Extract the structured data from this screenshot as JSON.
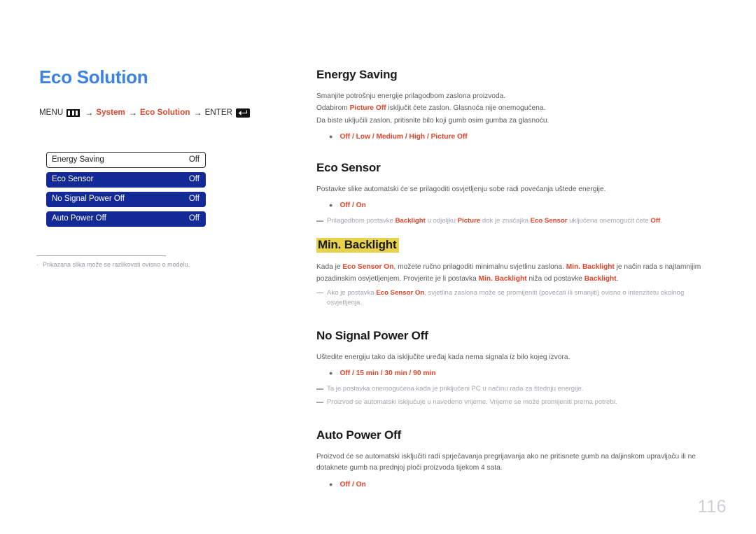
{
  "page": {
    "title": "Eco Solution",
    "number": "116"
  },
  "breadcrumb": {
    "menu_label": "MENU",
    "menu_icon": "menu-bars-icon",
    "arrow": "→",
    "step1": "System",
    "step2": "Eco Solution",
    "enter_label": "ENTER",
    "enter_icon": "enter-return-icon"
  },
  "osd": {
    "rows": [
      {
        "label": "Energy Saving",
        "value": "Off",
        "selected": true
      },
      {
        "label": "Eco Sensor",
        "value": "Off",
        "selected": false
      },
      {
        "label": "No Signal Power Off",
        "value": "Off",
        "selected": false
      },
      {
        "label": "Auto Power Off",
        "value": "Off",
        "selected": false
      }
    ]
  },
  "left_note": {
    "bullet": "·",
    "text": "Prikazana slika može se razlikovati ovisno o modelu."
  },
  "sections": {
    "energy_saving": {
      "title": "Energy Saving",
      "p1": "Smanjite potrošnju energije prilagodbom zaslona proizvoda.",
      "p2_a": "Odabirom ",
      "p2_b": "Picture Off",
      "p2_c": " isključit ćete zaslon. Glasnoća nije onemogućena.",
      "p3": "Da biste uključili zaslon, pritisnite bilo koji gumb osim gumba za glasnoću.",
      "options": "Off / Low / Medium / High / Picture Off"
    },
    "eco_sensor": {
      "title": "Eco Sensor",
      "p1": "Postavke slike automatski će se prilagoditi osvjetljenju sobe radi povećanja uštede energije.",
      "options": "Off / On",
      "note_a": "Prilagodbom postavke ",
      "note_b": "Backlight",
      "note_c": " u odjeljku ",
      "note_d": "Picture",
      "note_e": " dok je značajka ",
      "note_f": "Eco Sensor",
      "note_g": " uključena onemogućit ćete ",
      "note_h": "Off",
      "note_i": "."
    },
    "min_backlight": {
      "title": "Min. Backlight",
      "p1_a": "Kada je ",
      "p1_b": "Eco Sensor On",
      "p1_c": ", možete ručno prilagoditi minimalnu svjetlinu zaslona. ",
      "p1_d": "Min. Backlight",
      "p1_e": " je način rada s najtamnijim pozadinskim osvjetljenjem. Provjerite je li postavka ",
      "p1_f": "Min. Backlight",
      "p1_g": " niža od postavke ",
      "p1_h": "Backlight",
      "p1_i": ".",
      "note_a": "Ako je postavka ",
      "note_b": "Eco Sensor On",
      "note_c": ", svjetlina zaslona može se promijeniti (povećati ili smanjiti) ovisno o intenzitetu okolnog osvjetljenja."
    },
    "no_signal_power_off": {
      "title": "No Signal Power Off",
      "p1": "Uštedite energiju tako da isključite uređaj kada nema signala iz bilo kojeg izvora.",
      "options": "Off / 15 min / 30 min / 90 min",
      "note1": "Ta je postavka onemogućena kada je priključeni PC u načinu rada za štednju energije.",
      "note2": "Proizvod se automatski isključuje u navedeno vrijeme. Vrijeme se može promijeniti prema potrebi."
    },
    "auto_power_off": {
      "title": "Auto Power Off",
      "p1": "Proizvod će se automatski isključiti radi sprječavanja pregrijavanja ako ne pritisnete gumb na daljinskom upravljaču ili ne dotaknete gumb na prednjoj ploči proizvoda tijekom 4 sata.",
      "options": "Off / On"
    }
  },
  "colors": {
    "title_blue": "#3c82e0",
    "accent_red": "#e1442a",
    "osd_blue": "#132a96",
    "highlight_yellow": "#e6d24b",
    "page_number_gray": "#cfcfd6"
  }
}
